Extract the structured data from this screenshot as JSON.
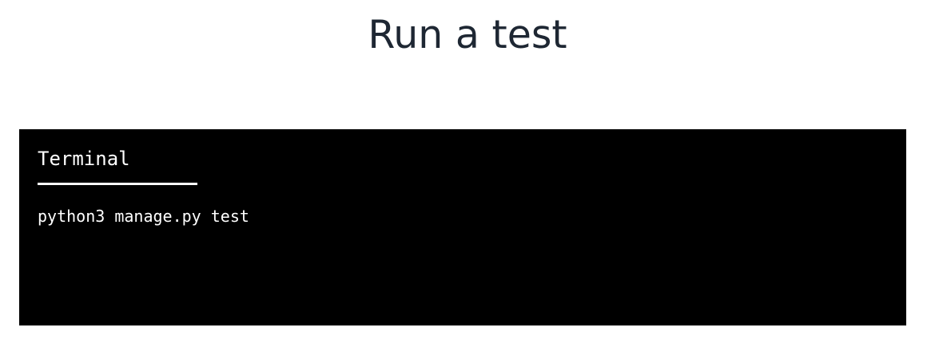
{
  "page": {
    "title": "Run a test"
  },
  "terminal": {
    "tab_label": "Terminal",
    "command": "python3 manage.py test",
    "colors": {
      "background": "#000000",
      "text": "#ffffff"
    }
  }
}
